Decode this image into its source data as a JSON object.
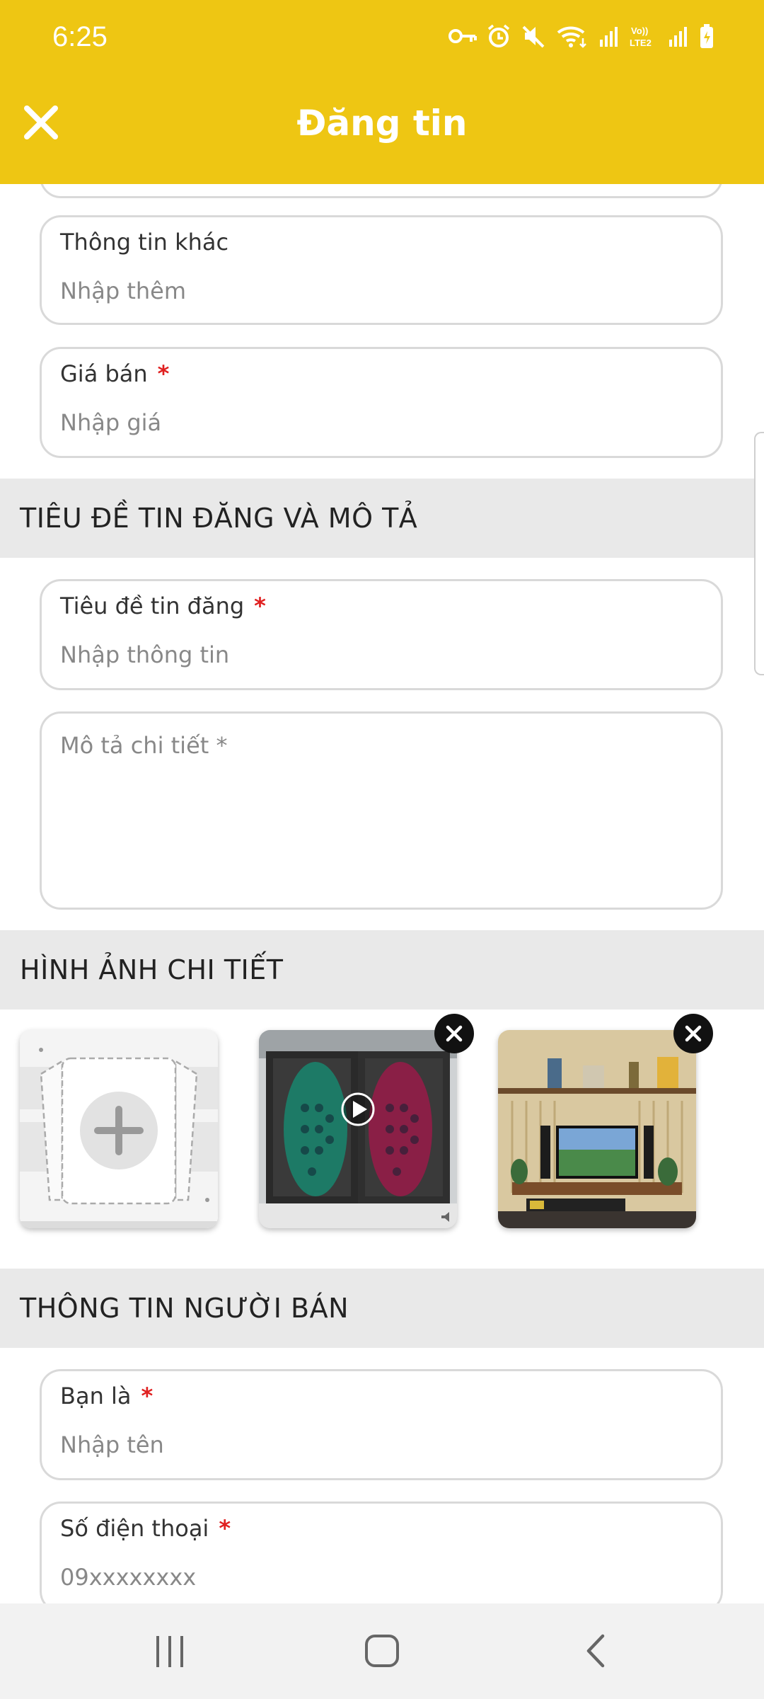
{
  "status": {
    "time": "6:25",
    "icons": [
      "vpn-key-icon",
      "alarm-icon",
      "mute-icon",
      "wifi-icon",
      "signal-icon",
      "volte-icon",
      "signal-icon",
      "battery-icon"
    ],
    "volte_text": "Vo))\nLTE2"
  },
  "header": {
    "title": "Đăng tin",
    "close_icon": "close-icon",
    "background": "#eec613"
  },
  "fields": {
    "other_info": {
      "label": "Thông tin khác",
      "placeholder": "Nhập thêm",
      "required": false
    },
    "price": {
      "label": "Giá bán",
      "placeholder": "Nhập giá",
      "required": true
    },
    "title": {
      "label": "Tiêu đề tin đăng",
      "placeholder": "Nhập thông tin",
      "required": true
    },
    "description": {
      "placeholder": "Mô tả chi tiết *"
    },
    "seller_name": {
      "label": "Bạn là",
      "placeholder": "Nhập tên",
      "required": true
    },
    "phone": {
      "label": "Số điện thoại",
      "placeholder": "09xxxxxxxx",
      "required": true
    }
  },
  "required_mark": "*",
  "sections": {
    "title_desc": "TIÊU ĐỀ TIN ĐĂNG VÀ MÔ TẢ",
    "images": "HÌNH ẢNH CHI TIẾT",
    "seller": "THÔNG TIN NGƯỜI BÁN"
  },
  "images": {
    "add_icon": "add-photo-icon",
    "items": [
      {
        "type": "video",
        "subject": "mouse-pair"
      },
      {
        "type": "photo",
        "subject": "desk-setup"
      }
    ]
  },
  "nav": {
    "recents": "recents-icon",
    "home": "home-icon",
    "back": "back-icon"
  }
}
